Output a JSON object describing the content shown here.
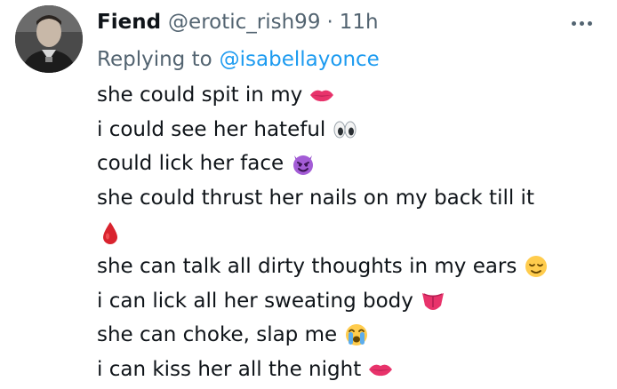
{
  "tweet": {
    "author_name": "Fiend",
    "handle": "@erotic_rish99",
    "separator": "·",
    "time": "11h",
    "replying_prefix": "Replying to",
    "replying_to": "@isabellayonce",
    "lines": [
      {
        "text": "she could spit in my",
        "emoji": "lips-icon"
      },
      {
        "text": "i could see her hateful",
        "emoji": "eyes-icon"
      },
      {
        "text": "could lick her face",
        "emoji": "smiling-devil-icon"
      },
      {
        "text": "she could thrust her nails on my back till it",
        "emoji": ""
      },
      {
        "text": "",
        "emoji": "blood-drop-icon"
      },
      {
        "text": "she can talk all dirty thoughts in my ears",
        "emoji": "relieved-face-icon"
      },
      {
        "text": "i can lick all her sweating body",
        "emoji": "tongue-icon"
      },
      {
        "text": "she can choke, slap me",
        "emoji": "crying-face-icon"
      },
      {
        "text": "i can kiss her all the night",
        "emoji": "lips-icon"
      }
    ]
  },
  "colors": {
    "text": "#0f1419",
    "secondary": "#536471",
    "link": "#1d9bf0"
  }
}
